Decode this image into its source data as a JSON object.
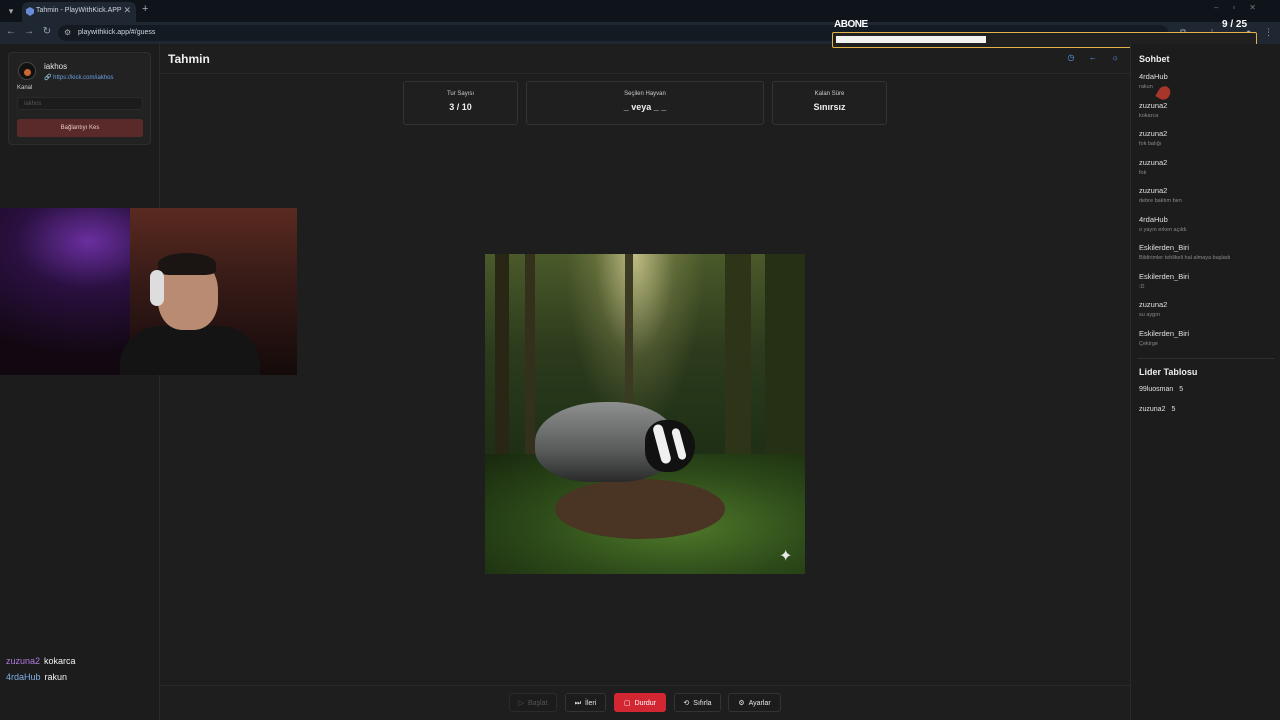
{
  "browser": {
    "tab_title": "Tahmin - PlayWithKick.APP",
    "url": "playwithkick.app/#/guess"
  },
  "overlay": {
    "label": "ABONE",
    "count": "9 / 25",
    "progress": 0.36
  },
  "channel": {
    "name": "iakhos",
    "link": "https://kick.com/iakhos",
    "label": "Kanal",
    "input_value": "iakhos",
    "disconnect_label": "Bağlantıyı Kes"
  },
  "stream_chat": [
    {
      "user": "zuzuna2",
      "message": "kokarca"
    },
    {
      "user": "4rdaHub",
      "message": "rakun"
    }
  ],
  "main": {
    "title": "Tahmin",
    "stats": {
      "round_label": "Tur Sayısı",
      "round_value": "3 / 10",
      "animal_label": "Seçilen Hayvan",
      "animal_value": "_ veya _ _",
      "time_label": "Kalan Süre",
      "time_value": "Sınırsız"
    }
  },
  "toolbar": {
    "start": "Başlat",
    "next": "İleri",
    "stop": "Durdur",
    "reset": "Sıfırla",
    "settings": "Ayarlar"
  },
  "sidebar": {
    "chat_title": "Sohbet",
    "chat": [
      {
        "user": "4rdaHub",
        "message": "rakun"
      },
      {
        "user": "zuzuna2",
        "message": "kokarca"
      },
      {
        "user": "zuzuna2",
        "message": "fok balığı"
      },
      {
        "user": "zuzuna2",
        "message": "fok"
      },
      {
        "user": "zuzuna2",
        "message": "debre baktım ben"
      },
      {
        "user": "4rdaHub",
        "message": "o yayın erken açıldı"
      },
      {
        "user": "Eskilerden_Biri",
        "message": "Bildirimler tehlikeli hal almaya başladı"
      },
      {
        "user": "Eskilerden_Biri",
        "message": ":D"
      },
      {
        "user": "zuzuna2",
        "message": "su aygırı"
      },
      {
        "user": "Eskilerden_Biri",
        "message": "Çekirge"
      }
    ],
    "leaderboard_title": "Lider Tablosu",
    "leaderboard": [
      {
        "user": "99luosman",
        "score": "5"
      },
      {
        "user": "zuzuna2",
        "score": "5"
      }
    ]
  }
}
